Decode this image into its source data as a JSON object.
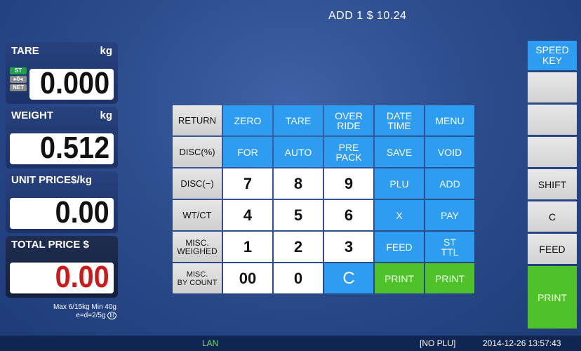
{
  "top_message": "ADD 1 $ 10.24",
  "tare": {
    "label": "TARE",
    "unit": "kg",
    "value": "0.000",
    "indicators": [
      "ST",
      "▸0◂",
      "NET"
    ]
  },
  "weight": {
    "label": "WEIGHT",
    "unit": "kg",
    "value": "0.512"
  },
  "unit_price": {
    "label": "UNIT PRICE$/kg",
    "value": "0.00"
  },
  "total_price": {
    "label": "TOTAL PRICE  $",
    "value": "0.00"
  },
  "capacity": {
    "line1": "Max 6/15kg Min 40g",
    "line2": "e=d=2/5g",
    "class_mark": "III"
  },
  "keypad": [
    [
      "RETURN",
      "ZERO",
      "TARE",
      "OVER\nRIDE",
      "DATE\nTIME",
      "MENU"
    ],
    [
      "DISC(%)",
      "FOR",
      "AUTO",
      "PRE\nPACK",
      "SAVE",
      "VOID"
    ],
    [
      "DISC(−)",
      "7",
      "8",
      "9",
      "PLU",
      "ADD"
    ],
    [
      "WT/CT",
      "4",
      "5",
      "6",
      "X",
      "PAY"
    ],
    [
      "MISC.\nWEIGHED",
      "1",
      "2",
      "3",
      "FEED",
      "ST\nTTL"
    ],
    [
      "MISC.\nBY COUNT",
      "00",
      "0",
      "C",
      "PRINT",
      "PRINT"
    ]
  ],
  "right_keys": {
    "speed_key": "SPEED\nKEY",
    "blank1": "",
    "blank2": "",
    "blank3": "",
    "shift": "SHIFT",
    "c": "C",
    "feed": "FEED",
    "print": "PRINT"
  },
  "status": {
    "network": "LAN",
    "plu": "[NO PLU]",
    "datetime": "2014-12-26 13:57:43"
  }
}
